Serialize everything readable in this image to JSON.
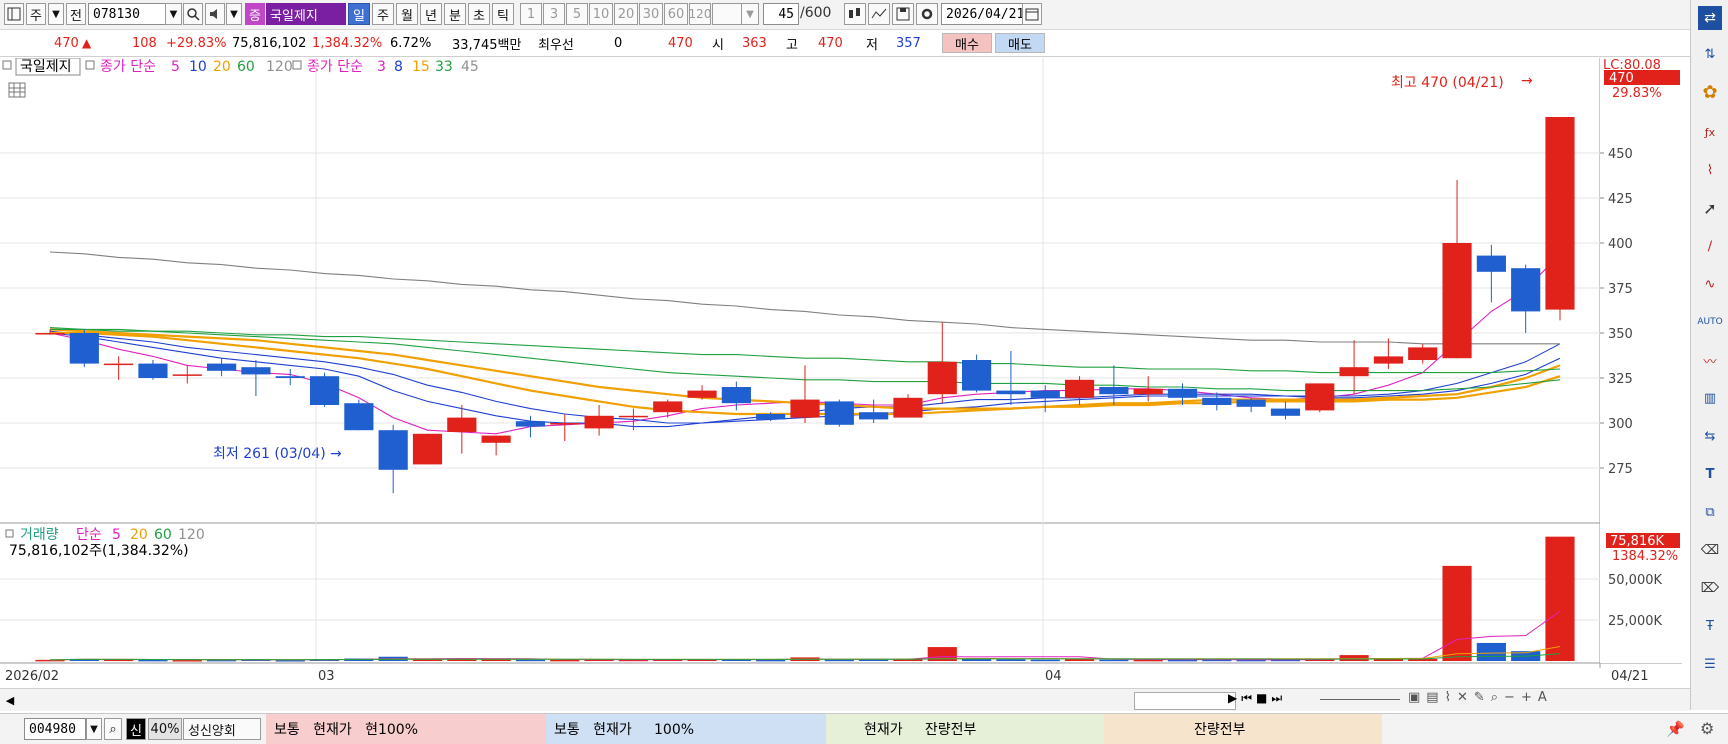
{
  "toolbar": {
    "market_type": "주",
    "prev_label": "전",
    "code": "078130",
    "name_type_badge": "증",
    "stock_name": "국일제지",
    "periods": [
      "일",
      "주",
      "월",
      "년",
      "분",
      "초",
      "틱"
    ],
    "selected_period": "일",
    "intervals": [
      "1",
      "3",
      "5",
      "10",
      "20",
      "30",
      "60",
      "120"
    ],
    "count": "45",
    "count_total": "/600",
    "date": "2026/04/21"
  },
  "quote": {
    "price": "470",
    "change": "108",
    "change_pct": "+29.83%",
    "volume": "75,816,102",
    "volume_pct": "1,384.32%",
    "turnover": "6.72%",
    "amount": "33,745백만",
    "priority_label": "최우선",
    "priority_value": "0",
    "bid": "470",
    "open_label": "시",
    "open": "363",
    "high_label": "고",
    "high": "470",
    "low_label": "저",
    "low": "357",
    "buy_label": "매수",
    "sell_label": "매도"
  },
  "price_legend": {
    "name": "국일제지",
    "ma_label": "종가 단순",
    "ma_periods": [
      "5",
      "10",
      "20",
      "60",
      "120"
    ],
    "ma_colors": [
      "#e020c0",
      "#1f3fd0",
      "#f0a000",
      "#20a040",
      "#808080"
    ],
    "ma2_label": "종가 단순",
    "ma2_periods": [
      "3",
      "8",
      "15",
      "33",
      "45"
    ],
    "ma2_colors": [
      "#e020c0",
      "#1f3fd0",
      "#f0a000",
      "#20a040",
      "#808080"
    ]
  },
  "volume_legend": {
    "name": "거래량",
    "ma_label": "단순",
    "periods": [
      "5",
      "20",
      "60",
      "120"
    ],
    "colors": [
      "#e020c0",
      "#f0a000",
      "#20a040",
      "#808080"
    ],
    "value_text": "75,816,102주(1,384.32%)"
  },
  "annotations": {
    "high_text": "최고 470 (04/21)",
    "low_text": "최저 261 (03/04)",
    "lc_text": "LC:80.08",
    "last_price_tag": "470",
    "last_pct_tag": "29.83%",
    "vol_tag": "75,816K",
    "vol_pct_tag": "1384.32%"
  },
  "colors": {
    "up": "#e0221b",
    "down": "#1f5fd0",
    "selected": "#3f6fd0"
  },
  "chart_data": [
    {
      "type": "candlestick",
      "title": "국일제지",
      "y_ticks": [
        275,
        300,
        325,
        350,
        375,
        400,
        425,
        450
      ],
      "ylim": [
        247,
        480
      ],
      "x_labels": [
        "2026/02",
        "03",
        "04",
        "04/21"
      ],
      "candles": [
        {
          "o": 350,
          "h": 352,
          "l": 349,
          "c": 350
        },
        {
          "o": 350,
          "h": 352,
          "l": 331,
          "c": 333
        },
        {
          "o": 333,
          "h": 337,
          "l": 324,
          "c": 333
        },
        {
          "o": 333,
          "h": 335,
          "l": 324,
          "c": 325
        },
        {
          "o": 327,
          "h": 332,
          "l": 322,
          "c": 327
        },
        {
          "o": 333,
          "h": 336,
          "l": 326,
          "c": 329
        },
        {
          "o": 331,
          "h": 335,
          "l": 315,
          "c": 327
        },
        {
          "o": 326,
          "h": 330,
          "l": 321,
          "c": 325
        },
        {
          "o": 326,
          "h": 328,
          "l": 309,
          "c": 310
        },
        {
          "o": 311,
          "h": 313,
          "l": 296,
          "c": 296
        },
        {
          "o": 296,
          "h": 299,
          "l": 261,
          "c": 274
        },
        {
          "o": 277,
          "h": 294,
          "l": 277,
          "c": 294
        },
        {
          "o": 295,
          "h": 310,
          "l": 283,
          "c": 303
        },
        {
          "o": 289,
          "h": 292,
          "l": 282,
          "c": 293
        },
        {
          "o": 301,
          "h": 304,
          "l": 292,
          "c": 298
        },
        {
          "o": 300,
          "h": 305,
          "l": 290,
          "c": 300
        },
        {
          "o": 297,
          "h": 310,
          "l": 293,
          "c": 304
        },
        {
          "o": 304,
          "h": 308,
          "l": 296,
          "c": 304
        },
        {
          "o": 306,
          "h": 313,
          "l": 303,
          "c": 312
        },
        {
          "o": 314,
          "h": 321,
          "l": 313,
          "c": 318
        },
        {
          "o": 320,
          "h": 323,
          "l": 307,
          "c": 311
        },
        {
          "o": 305,
          "h": 306,
          "l": 301,
          "c": 302
        },
        {
          "o": 303,
          "h": 332,
          "l": 300,
          "c": 313
        },
        {
          "o": 312,
          "h": 313,
          "l": 298,
          "c": 299
        },
        {
          "o": 306,
          "h": 313,
          "l": 300,
          "c": 302
        },
        {
          "o": 303,
          "h": 316,
          "l": 303,
          "c": 314
        },
        {
          "o": 316,
          "h": 356,
          "l": 311,
          "c": 334
        },
        {
          "o": 335,
          "h": 338,
          "l": 317,
          "c": 318
        },
        {
          "o": 318,
          "h": 340,
          "l": 310,
          "c": 316
        },
        {
          "o": 318,
          "h": 321,
          "l": 306,
          "c": 314
        },
        {
          "o": 314,
          "h": 326,
          "l": 310,
          "c": 324
        },
        {
          "o": 320,
          "h": 332,
          "l": 310,
          "c": 316
        },
        {
          "o": 316,
          "h": 326,
          "l": 312,
          "c": 319
        },
        {
          "o": 319,
          "h": 322,
          "l": 310,
          "c": 314
        },
        {
          "o": 314,
          "h": 317,
          "l": 307,
          "c": 310
        },
        {
          "o": 313,
          "h": 314,
          "l": 306,
          "c": 309
        },
        {
          "o": 308,
          "h": 312,
          "l": 302,
          "c": 304
        },
        {
          "o": 307,
          "h": 322,
          "l": 306,
          "c": 322
        },
        {
          "o": 326,
          "h": 346,
          "l": 316,
          "c": 331
        },
        {
          "o": 333,
          "h": 347,
          "l": 330,
          "c": 337
        },
        {
          "o": 335,
          "h": 344,
          "l": 333,
          "c": 342
        },
        {
          "o": 336,
          "h": 435,
          "l": 336,
          "c": 400
        },
        {
          "o": 393,
          "h": 399,
          "l": 367,
          "c": 384
        },
        {
          "o": 386,
          "h": 388,
          "l": 350,
          "c": 362
        },
        {
          "o": 363,
          "h": 470,
          "l": 357,
          "c": 470
        }
      ],
      "ma_lines": [
        {
          "period": "5",
          "color": "#e020c0",
          "values": [
            350,
            346,
            341,
            337,
            332,
            330,
            328,
            327,
            322,
            314,
            303,
            296,
            295,
            294,
            298,
            299,
            300,
            301,
            304,
            308,
            310,
            311,
            312,
            311,
            310,
            310,
            314,
            316,
            317,
            318,
            318,
            319,
            319,
            318,
            316,
            314,
            313,
            314,
            316,
            321,
            328,
            345,
            362,
            374,
            394
          ]
        },
        {
          "period": "10",
          "color": "#1f3fd0",
          "values": [
            350,
            348,
            345,
            342,
            339,
            336,
            334,
            332,
            330,
            326,
            318,
            312,
            308,
            304,
            301,
            300,
            300,
            298,
            298,
            300,
            302,
            304,
            306,
            308,
            309,
            309,
            311,
            313,
            313,
            314,
            314,
            315,
            316,
            316,
            316,
            316,
            315,
            315,
            315,
            316,
            318,
            322,
            328,
            334,
            344
          ]
        },
        {
          "period": "15",
          "color": "#1f3fd0",
          "values": [
            351,
            349,
            347,
            345,
            342,
            340,
            338,
            336,
            334,
            331,
            327,
            321,
            317,
            312,
            308,
            305,
            303,
            302,
            300,
            300,
            301,
            302,
            303,
            304,
            305,
            306,
            308,
            309,
            311,
            312,
            313,
            314,
            315,
            315,
            315,
            315,
            315,
            314,
            314,
            315,
            316,
            318,
            322,
            327,
            336
          ]
        },
        {
          "period": "20",
          "color": "#f0a000",
          "values": [
            350,
            350,
            349,
            348,
            346,
            344,
            342,
            340,
            338,
            336,
            333,
            330,
            326,
            322,
            318,
            315,
            312,
            309,
            307,
            306,
            305,
            305,
            305,
            305,
            305,
            305,
            306,
            307,
            308,
            309,
            310,
            311,
            311,
            312,
            313,
            313,
            313,
            313,
            313,
            314,
            315,
            316,
            320,
            325,
            332
          ]
        },
        {
          "period": "33",
          "color": "#f0a000",
          "values": [
            352,
            351,
            350,
            349,
            348,
            347,
            346,
            344,
            342,
            340,
            338,
            335,
            332,
            329,
            326,
            323,
            320,
            318,
            316,
            314,
            313,
            312,
            311,
            310,
            309,
            308,
            308,
            308,
            308,
            309,
            309,
            310,
            310,
            311,
            311,
            312,
            312,
            312,
            312,
            313,
            313,
            314,
            317,
            320,
            326
          ]
        },
        {
          "period": "45",
          "color": "#20a040",
          "values": [
            352,
            352,
            351,
            351,
            350,
            349,
            348,
            347,
            346,
            345,
            344,
            342,
            340,
            338,
            336,
            334,
            332,
            330,
            328,
            327,
            326,
            325,
            324,
            324,
            323,
            323,
            323,
            322,
            322,
            322,
            321,
            321,
            320,
            320,
            319,
            319,
            318,
            318,
            318,
            318,
            318,
            319,
            320,
            322,
            324
          ]
        },
        {
          "period": "60",
          "color": "#20a040",
          "values": [
            353,
            352,
            352,
            351,
            351,
            350,
            349,
            349,
            348,
            348,
            347,
            346,
            345,
            344,
            343,
            342,
            341,
            340,
            339,
            338,
            338,
            337,
            336,
            336,
            335,
            334,
            334,
            333,
            333,
            332,
            331,
            331,
            330,
            330,
            330,
            329,
            329,
            328,
            328,
            328,
            328,
            328,
            328,
            329,
            330
          ]
        },
        {
          "period": "120",
          "color": "#808080",
          "values": [
            395,
            394,
            392,
            391,
            389,
            388,
            386,
            385,
            383,
            382,
            380,
            379,
            377,
            376,
            374,
            373,
            371,
            369,
            368,
            366,
            365,
            363,
            362,
            360,
            359,
            357,
            356,
            355,
            353,
            352,
            351,
            350,
            349,
            348,
            347,
            346,
            346,
            345,
            345,
            345,
            344,
            344,
            344,
            344,
            344
          ]
        }
      ]
    },
    {
      "type": "bar",
      "title": "거래량",
      "y_ticks": [
        "25,000K",
        "50,000K"
      ],
      "ylim": [
        0,
        80000000
      ],
      "volumes": [
        700000,
        1300000,
        900000,
        700000,
        600000,
        700000,
        900000,
        600000,
        1100000,
        1500000,
        2600000,
        1200000,
        1100000,
        900000,
        800000,
        700000,
        900000,
        800000,
        900000,
        1000000,
        900000,
        700000,
        2200000,
        800000,
        900000,
        1000000,
        8500000,
        1400000,
        1000000,
        800000,
        1200000,
        800000,
        700000,
        700000,
        800000,
        700000,
        800000,
        1300000,
        3600000,
        1200000,
        1300000,
        58000000,
        11000000,
        6000000,
        75816102
      ]
    }
  ],
  "bottom": {
    "code": "004980",
    "badge": "신",
    "pct": "40%",
    "name": "성신양회",
    "panel1": "보통   현재가   현100%",
    "panel2": "보통   현재가     100%",
    "panel3": "현재가     잔량전부",
    "panel4": "잔량전부"
  }
}
